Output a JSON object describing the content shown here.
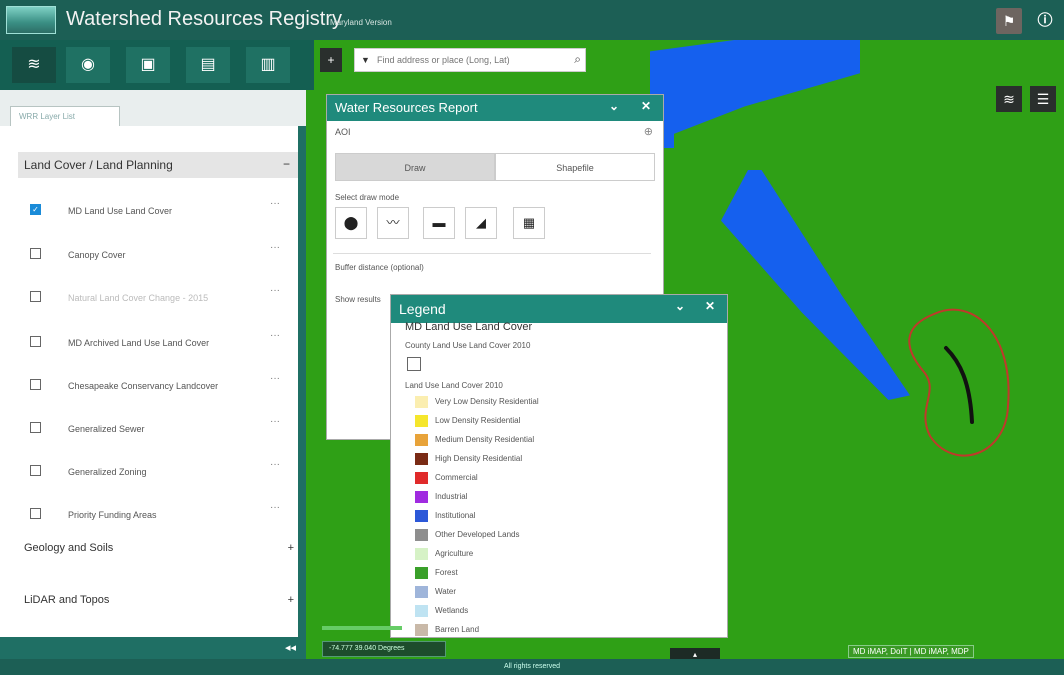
{
  "header": {
    "title": "Watershed Resources Registry",
    "subtitle": "Maryland Version",
    "bookmark_icon": "bookmark-icon",
    "info_icon": "info-icon"
  },
  "toolbar": {
    "buttons": [
      "layers-icon",
      "globe-icon",
      "chat-icon",
      "data-icon",
      "print-icon"
    ]
  },
  "layer_panel": {
    "tab_label": "WRR Layer List",
    "group_title": "Land Cover / Land Planning",
    "group_toggle": "−",
    "layers": [
      {
        "label": "MD Land Use Land Cover",
        "checked": true
      },
      {
        "label": "Canopy Cover",
        "checked": false
      },
      {
        "label": "Natural Land Cover Change - 2015",
        "checked": false
      },
      {
        "label": "MD Archived Land Use Land Cover",
        "checked": false
      },
      {
        "label": "Chesapeake Conservancy Landcover",
        "checked": false
      },
      {
        "label": "Generalized Sewer",
        "checked": false
      },
      {
        "label": "Generalized Zoning",
        "checked": false
      },
      {
        "label": "Priority Funding Areas",
        "checked": false
      }
    ],
    "menu_glyph": "···",
    "sections": [
      {
        "label": "Geology and Soils",
        "toggle": "+"
      },
      {
        "label": "LiDAR and Topos",
        "toggle": "+"
      }
    ],
    "collapse_glyph": "◂◂"
  },
  "map": {
    "search_placeholder": "Find address or place (Long, Lat)",
    "zoom_in": "+",
    "coords": "-74.777 39.040 Degrees",
    "attribution": "MD iMAP, DoIT | MD iMAP, MDP",
    "handle": "▴",
    "colors": {
      "land": "#2fa016",
      "water": "#1560ee",
      "aoi_outline": "#c0392b"
    }
  },
  "report": {
    "title": "Water Resources Report",
    "aoi_label": "AOI",
    "tabs": [
      "Draw",
      "Shapefile"
    ],
    "draw_mode_label": "Select draw mode",
    "draw_modes": [
      "point-icon",
      "polyline-icon",
      "rectangle-icon",
      "polygon-icon",
      "select-feature-icon"
    ],
    "buffer_label": "Buffer distance (optional)",
    "show_results_label": "Show results"
  },
  "legend": {
    "title": "Legend",
    "heading": "MD Land Use Land Cover",
    "county_label": "County Land Use Land Cover 2010",
    "lulc_label": "Land Use Land Cover 2010",
    "items": [
      {
        "label": "Very Low Density Residential",
        "color": "#fbeeb0"
      },
      {
        "label": "Low Density Residential",
        "color": "#f5e62c"
      },
      {
        "label": "Medium Density Residential",
        "color": "#e8a33a"
      },
      {
        "label": "High Density Residential",
        "color": "#7a2b15"
      },
      {
        "label": "Commercial",
        "color": "#e02a2a"
      },
      {
        "label": "Industrial",
        "color": "#a02be0"
      },
      {
        "label": "Institutional",
        "color": "#2c58d8"
      },
      {
        "label": "Other Developed Lands",
        "color": "#8e8e8e"
      },
      {
        "label": "Agriculture",
        "color": "#d6f2c6"
      },
      {
        "label": "Forest",
        "color": "#3aa02a"
      },
      {
        "label": "Water",
        "color": "#9fb5da"
      },
      {
        "label": "Wetlands",
        "color": "#bfe3f2"
      },
      {
        "label": "Barren Land",
        "color": "#c9b9a8"
      }
    ]
  },
  "footer": {
    "text": "All rights reserved"
  }
}
